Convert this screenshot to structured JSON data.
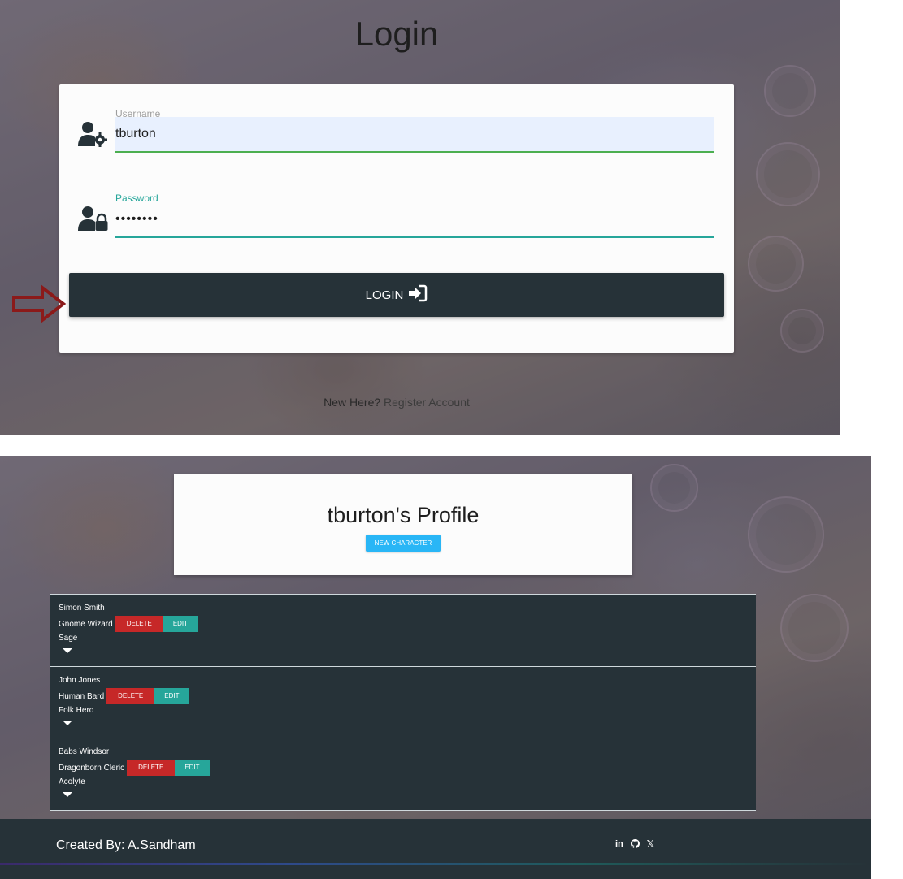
{
  "login": {
    "title": "Login",
    "username_label": "Username",
    "username_value": "tburton",
    "password_label": "Password",
    "password_value": "••••••••",
    "login_button": "LOGIN",
    "register_prompt": "New Here?",
    "register_link": "Register Account"
  },
  "profile": {
    "title": "tburton's Profile",
    "new_character_button": "NEW CHARACTER",
    "characters": [
      {
        "name": "Simon Smith",
        "race_class": "Gnome Wizard",
        "background": "Sage",
        "delete": "DELETE",
        "edit": "EDIT"
      },
      {
        "name": "John Jones",
        "race_class": "Human Bard",
        "background": "Folk Hero",
        "delete": "DELETE",
        "edit": "EDIT"
      },
      {
        "name": "Babs Windsor",
        "race_class": "Dragonborn Cleric",
        "background": "Acolyte",
        "delete": "DELETE",
        "edit": "EDIT"
      }
    ]
  },
  "footer": {
    "created_by": "Created By: A.Sandham",
    "icons": [
      "linkedin-icon",
      "github-icon",
      "x-icon"
    ],
    "linkedin_text": "in",
    "x_text": "𝕏"
  },
  "colors": {
    "dark": "#263238",
    "teal": "#26a69a",
    "red": "#c62828",
    "light_blue": "#29b6f6",
    "arrow": "#8b1a1a"
  }
}
